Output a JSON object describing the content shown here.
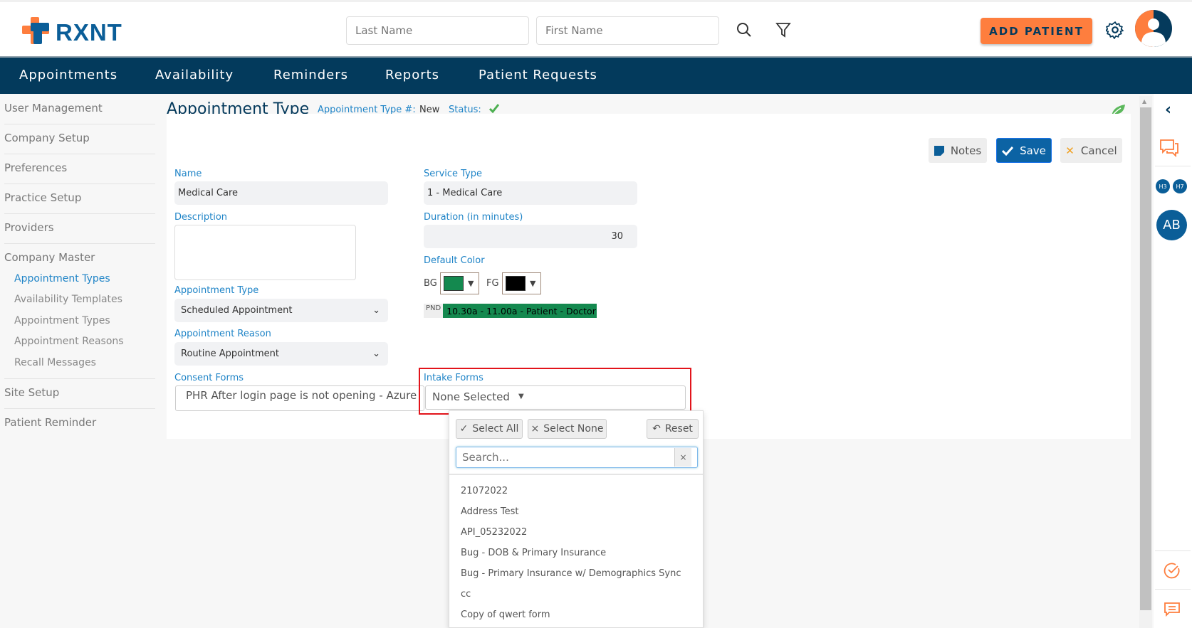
{
  "header": {
    "logo": "RXNT",
    "last_name_placeholder": "Last Name",
    "first_name_placeholder": "First Name",
    "add_patient": "ADD PATIENT"
  },
  "nav": [
    "Appointments",
    "Availability",
    "Reminders",
    "Reports",
    "Patient Requests"
  ],
  "sidebar": {
    "items": [
      "User Management",
      "Company Setup",
      "Preferences",
      "Practice Setup",
      "Providers",
      "Company Master"
    ],
    "sub_items": [
      "Appointment Types",
      "Availability Templates",
      "Appointment Types",
      "Appointment Reasons",
      "Recall Messages"
    ],
    "bottom_items": [
      "Site Setup",
      "Patient Reminder"
    ]
  },
  "page": {
    "title": "Appointment Type",
    "type_num_label": "Appointment Type #:",
    "type_num_value": "New",
    "status_label": "Status:"
  },
  "toolbar": {
    "notes": "Notes",
    "save": "Save",
    "cancel": "Cancel"
  },
  "form": {
    "name_label": "Name",
    "name_value": "Medical Care",
    "service_type_label": "Service Type",
    "service_type_value": "1 - Medical Care",
    "description_label": "Description",
    "description_value": "",
    "duration_label": "Duration (in minutes)",
    "duration_value": "30",
    "default_color_label": "Default Color",
    "bg_label": "BG",
    "fg_label": "FG",
    "bg_color": "#14894f",
    "fg_color": "#000000",
    "preview_tag": "PND",
    "preview_text": "10.30a - 11.00a - Patient - Doctor",
    "appt_type_label": "Appointment Type",
    "appt_type_value": "Scheduled Appointment",
    "appt_reason_label": "Appointment Reason",
    "appt_reason_value": "Routine Appointment",
    "consent_label": "Consent Forms",
    "consent_value": "PHR After login page is not opening - Azure",
    "intake_label": "Intake Forms",
    "intake_value": "None Selected"
  },
  "dropdown": {
    "select_all": "Select All",
    "select_none": "Select None",
    "reset": "Reset",
    "search_placeholder": "Search...",
    "options": [
      "21072022",
      "Address Test",
      "API_05232022",
      "Bug - DOB & Primary Insurance",
      "Bug - Primary Insurance w/ Demographics Sync",
      "cc",
      "Copy of qwert form"
    ]
  },
  "right_panel": {
    "badges": [
      "H3",
      "H7"
    ],
    "avatar": "AB"
  }
}
